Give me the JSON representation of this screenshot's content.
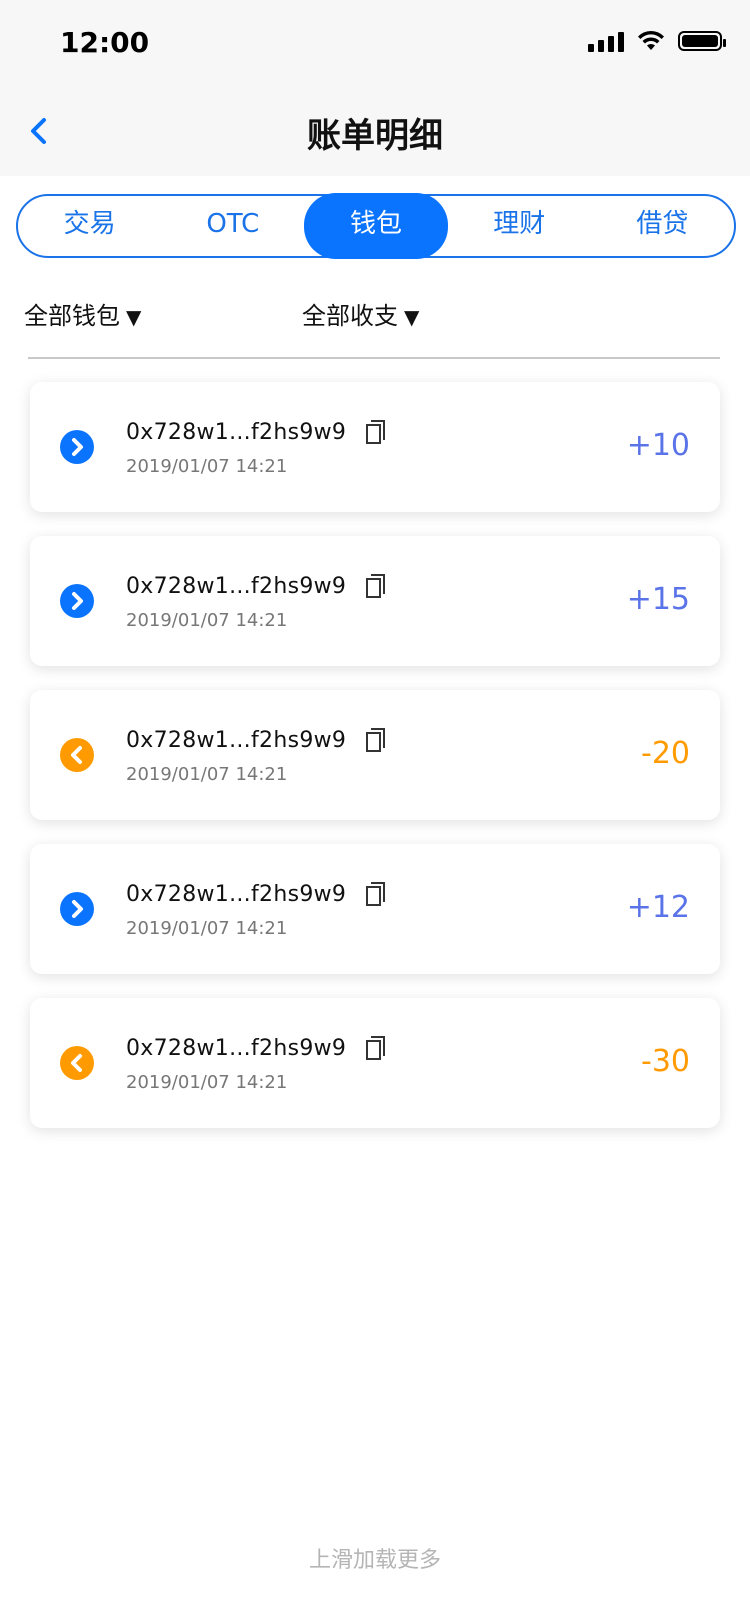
{
  "status_bar": {
    "time": "12:00"
  },
  "navbar": {
    "title": "账单明细"
  },
  "tabs": [
    {
      "label": "交易",
      "active": false
    },
    {
      "label": "OTC",
      "active": false
    },
    {
      "label": "钱包",
      "active": true
    },
    {
      "label": "理财",
      "active": false
    },
    {
      "label": "借贷",
      "active": false
    }
  ],
  "filters": {
    "wallet_label": "全部钱包",
    "type_label": "全部收支",
    "caret": "▼"
  },
  "transactions": [
    {
      "direction": "in",
      "address": "0x728w1...f2hs9w9",
      "datetime": "2019/01/07 14:21",
      "amount": "+10"
    },
    {
      "direction": "in",
      "address": "0x728w1...f2hs9w9",
      "datetime": "2019/01/07 14:21",
      "amount": "+15"
    },
    {
      "direction": "out",
      "address": "0x728w1...f2hs9w9",
      "datetime": "2019/01/07 14:21",
      "amount": "-20"
    },
    {
      "direction": "in",
      "address": "0x728w1...f2hs9w9",
      "datetime": "2019/01/07 14:21",
      "amount": "+12"
    },
    {
      "direction": "out",
      "address": "0x728w1...f2hs9w9",
      "datetime": "2019/01/07 14:21",
      "amount": "-30"
    }
  ],
  "footer": {
    "load_more": "上滑加载更多"
  },
  "colors": {
    "primary": "#0a74ff",
    "incoming": "#5a73e8",
    "outgoing": "#ff9b00"
  }
}
